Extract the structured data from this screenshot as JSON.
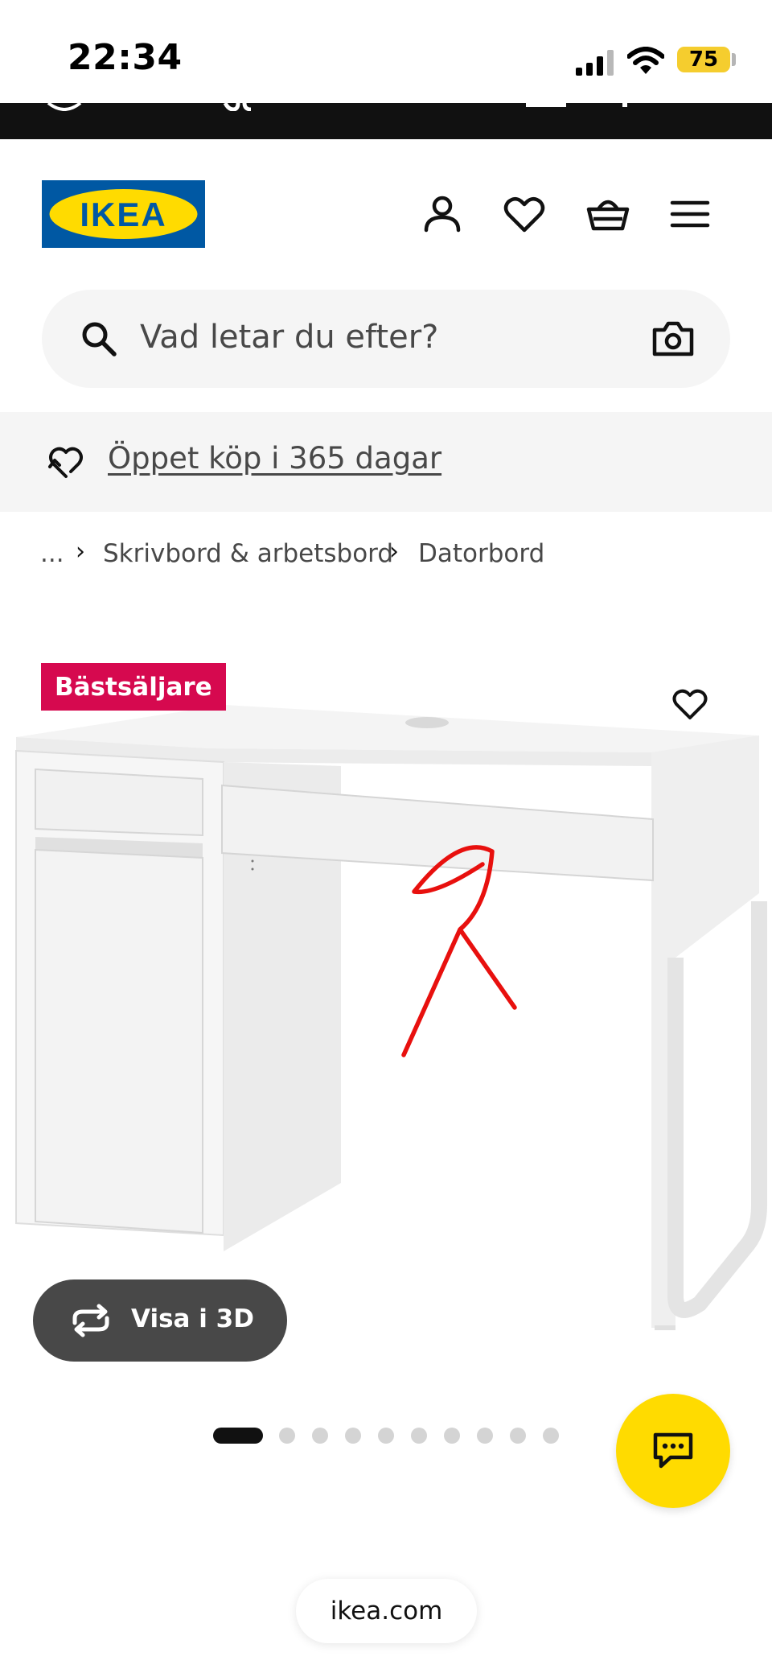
{
  "status_bar": {
    "time": "22:34",
    "battery": "75",
    "icons": [
      "cellular-signal-icon",
      "wifi-icon",
      "battery-icon"
    ]
  },
  "header": {
    "logo_text": "IKEA",
    "icons": [
      "profile-icon",
      "favorites-heart-icon",
      "cart-basket-icon",
      "menu-hamburger-icon"
    ]
  },
  "search": {
    "placeholder": "Vad letar du efter?",
    "icons": [
      "search-icon",
      "camera-icon"
    ]
  },
  "banner": {
    "text": "Öppet köp i 365 dagar",
    "icon": "return-heart-icon"
  },
  "breadcrumb": {
    "items": [
      "...",
      "Skrivbord & arbetsbord",
      "Datorbord"
    ]
  },
  "product": {
    "badge": "Bästsäljare",
    "view_3d_label": "Visa i 3D",
    "image_count": 10,
    "active_image": 1
  },
  "chat": {
    "icon": "chat-bubble-icon"
  },
  "browser": {
    "url": "ikea.com"
  },
  "colors": {
    "ikea_blue": "#0058a3",
    "ikea_yellow": "#ffdb00",
    "badge_pink": "#d6094f",
    "annotation_red": "#e8100e"
  }
}
